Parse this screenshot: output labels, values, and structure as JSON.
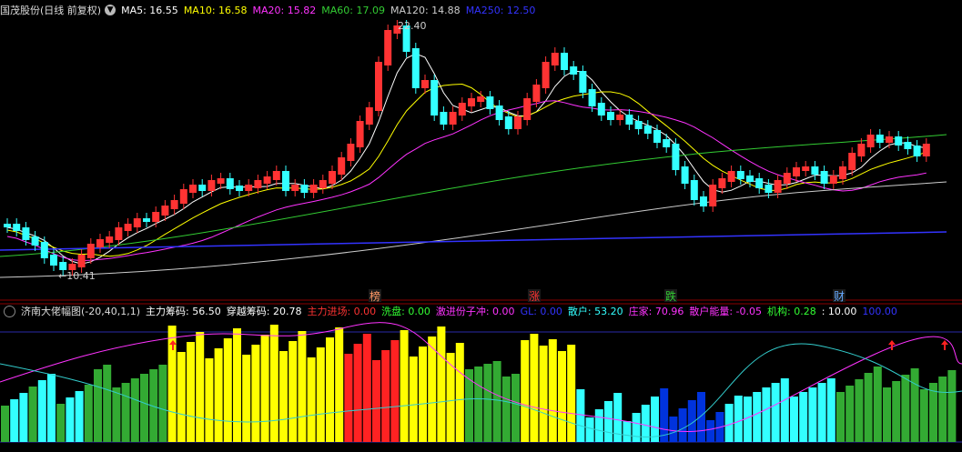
{
  "top_panel": {
    "title": "国茂股份(日线 前复权)",
    "indicators": [
      {
        "label": "MA5: 16.55",
        "color": "#ffffff"
      },
      {
        "label": "MA10: 16.58",
        "color": "#ffff00"
      },
      {
        "label": "MA20: 15.82",
        "color": "#ff33ff"
      },
      {
        "label": "MA60: 17.09",
        "color": "#33cc33"
      },
      {
        "label": "MA120: 14.88",
        "color": "#cccccc"
      },
      {
        "label": "MA250: 12.50",
        "color": "#3333ff"
      }
    ],
    "high_annotation": "22.40",
    "low_annotation": "←10.41",
    "markers": [
      {
        "label": "榜",
        "color": "#ff9966"
      },
      {
        "label": "涨",
        "color": "#ff3333"
      },
      {
        "label": "跌",
        "color": "#33cc33"
      },
      {
        "label": "财",
        "color": "#66aaff"
      }
    ]
  },
  "bottom_panel": {
    "title": "济南大佬幅图(-20,40,1,1)",
    "indicators": [
      {
        "label": "主力筹码: 56.50",
        "color": "#ffffff"
      },
      {
        "label": "穿越筹码: 20.78",
        "color": "#ffffff"
      },
      {
        "label": "主力进场: 0.00",
        "color": "#ff3333"
      },
      {
        "label": "洗盘: 0.00",
        "color": "#33ff33"
      },
      {
        "label": "激进份子冲: 0.00",
        "color": "#ff33ff"
      },
      {
        "label": "GL: 0.00",
        "color": "#3333ff"
      },
      {
        "label": "散户: 53.20",
        "color": "#33ffff"
      },
      {
        "label": "庄家: 70.96",
        "color": "#ff33ff"
      },
      {
        "label": "散户能量: -0.05",
        "color": "#ff33ff"
      },
      {
        "label": "机构: 0.28",
        "color": "#33ff33"
      },
      {
        "label": ": 10.00",
        "color": "#ffffff"
      },
      {
        "label": "100.00",
        "color": "#3333ff"
      }
    ]
  }
}
